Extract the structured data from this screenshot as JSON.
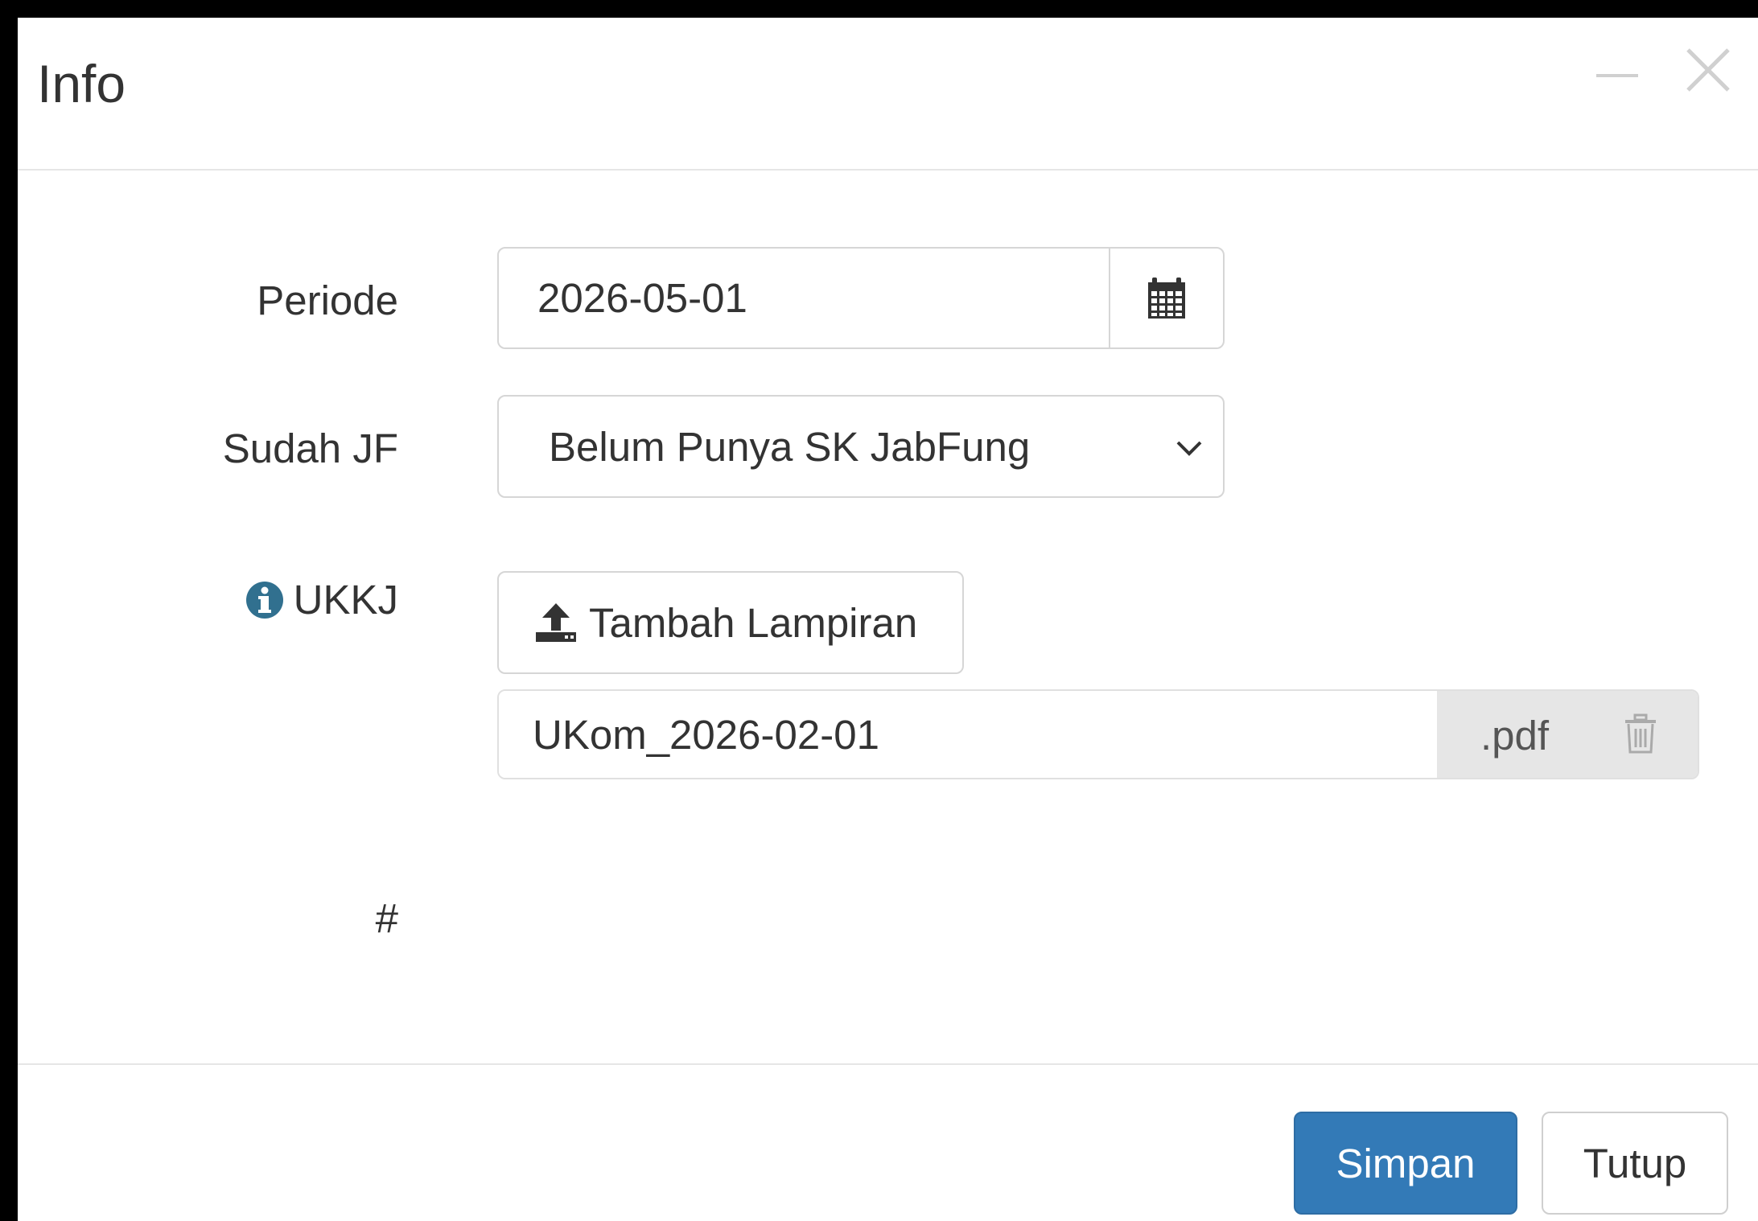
{
  "dialog": {
    "title": "Info"
  },
  "form": {
    "periode": {
      "label": "Periode",
      "value": "2026-05-01"
    },
    "sudah_jf": {
      "label": "Sudah JF",
      "selected": "Belum Punya SK JabFung"
    },
    "ukkj": {
      "label": "UKKJ",
      "upload_label": "Tambah Lampiran",
      "file_name": "UKom_2026-02-01",
      "file_ext": ".pdf"
    },
    "hash_label": "#"
  },
  "footer": {
    "save_label": "Simpan",
    "close_label": "Tutup"
  },
  "colors": {
    "primary": "#337ab7",
    "info_icon": "#31708f"
  },
  "icons": [
    "minimize-icon",
    "close-icon",
    "calendar-icon",
    "chevron-down-icon",
    "info-icon",
    "upload-icon",
    "trash-icon"
  ]
}
